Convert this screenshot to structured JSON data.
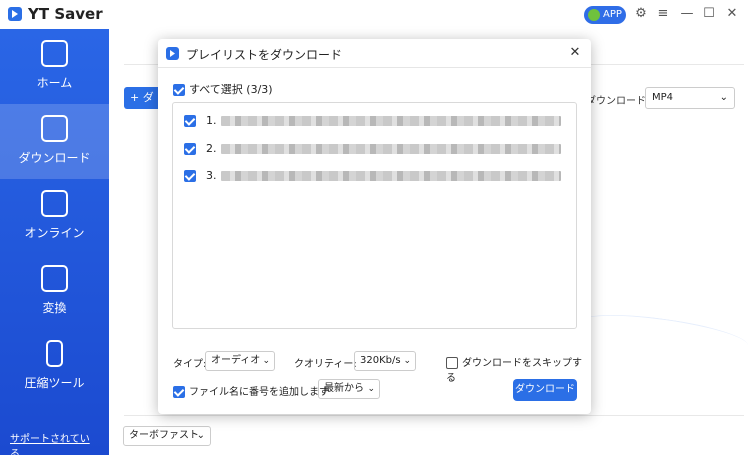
{
  "app": {
    "title": "YT Saver",
    "badge": "APP"
  },
  "sidebar": {
    "items": [
      {
        "label": "ホーム",
        "icon": "home-icon"
      },
      {
        "label": "ダウンロード",
        "icon": "download-icon",
        "active": true
      },
      {
        "label": "オンライン",
        "icon": "globe-icon"
      },
      {
        "label": "変換",
        "icon": "convert-icon"
      },
      {
        "label": "圧縮ツール",
        "icon": "compress-icon"
      }
    ],
    "support": "サポートされている..."
  },
  "main": {
    "add_button": "+ ダ",
    "download_label": "ダウンロード",
    "format": "MP4",
    "turbo": "ターボファスト"
  },
  "modal": {
    "title": "プレイリストをダウンロード",
    "select_all": "すべて選択",
    "select_count": "(3/3)",
    "items": [
      {
        "num": "1.",
        "checked": true
      },
      {
        "num": "2.",
        "checked": true
      },
      {
        "num": "3.",
        "checked": true
      }
    ],
    "type_label": "タイプ:",
    "type_value": "オーディオ",
    "quality_label": "クオリティー:",
    "quality_value": "320Kb/s",
    "skip_label": "ダウンロードをスキップする",
    "add_number_label": "ファイル名に番号を追加します",
    "order_value": "最新から",
    "download_button": "ダウンロード"
  },
  "colors": {
    "accent": "#2b6fe6",
    "sidebar": "#1f55d8"
  }
}
